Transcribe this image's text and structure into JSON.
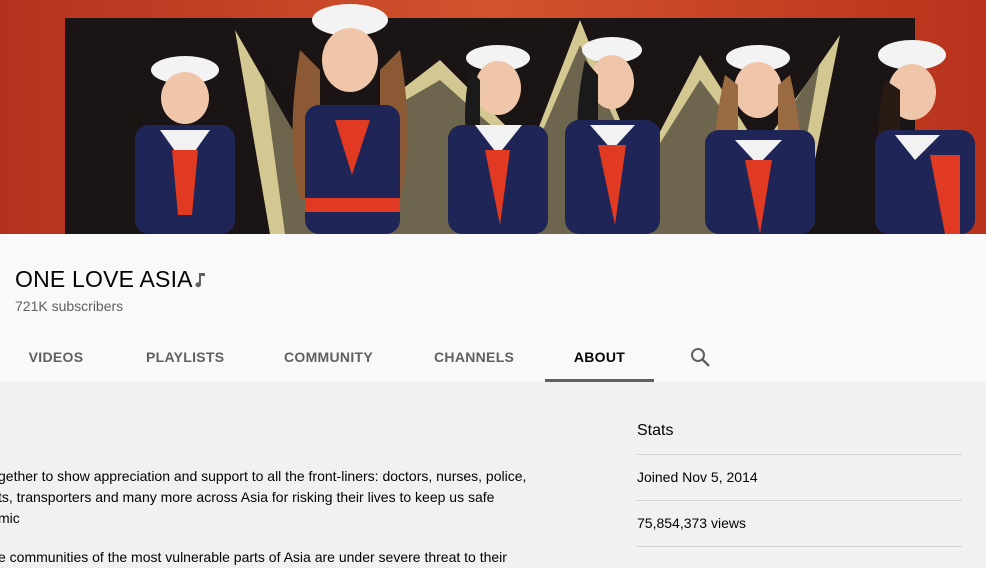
{
  "channel": {
    "name": "ONE LOVE ASIA",
    "subscribers": "721K subscribers",
    "badge_icon": "music-note-icon"
  },
  "tabs": [
    {
      "label": "VIDEOS",
      "active": false
    },
    {
      "label": "PLAYLISTS",
      "active": false
    },
    {
      "label": "COMMUNITY",
      "active": false
    },
    {
      "label": "CHANNELS",
      "active": false
    },
    {
      "label": "ABOUT",
      "active": true
    }
  ],
  "search_icon": "search-icon",
  "about": {
    "description_lines": [
      "gether to show appreciation and support to all the front-liners: doctors, nurses, police,",
      "ts, transporters and many more across Asia for risking their lives to keep us safe",
      "mic",
      "e communities of the most vulnerable parts of Asia are under severe threat to their"
    ]
  },
  "stats": {
    "title": "Stats",
    "joined": "Joined Nov 5, 2014",
    "views": "75,854,373 views"
  },
  "colors": {
    "banner_red": "#c33b24",
    "navy": "#1f2556",
    "active_underline": "#606060"
  }
}
